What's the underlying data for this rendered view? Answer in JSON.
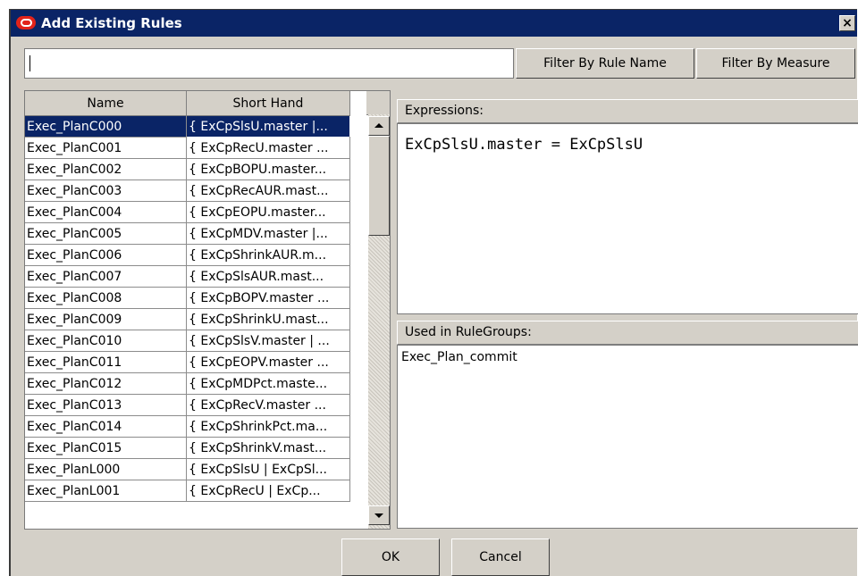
{
  "window": {
    "title": "Add Existing Rules",
    "close_label": "×"
  },
  "filter": {
    "value": "",
    "by_rule_name_label": "Filter By Rule Name",
    "by_measure_label": "Filter By Measure"
  },
  "table": {
    "columns": [
      "Name",
      "Short Hand"
    ],
    "selected_index": 0,
    "rows": [
      {
        "name": "Exec_PlanC000",
        "short": "{ ExCpSlsU.master |..."
      },
      {
        "name": "Exec_PlanC001",
        "short": "{ ExCpRecU.master ..."
      },
      {
        "name": "Exec_PlanC002",
        "short": "{ ExCpBOPU.master..."
      },
      {
        "name": "Exec_PlanC003",
        "short": "{ ExCpRecAUR.mast..."
      },
      {
        "name": "Exec_PlanC004",
        "short": "{ ExCpEOPU.master..."
      },
      {
        "name": "Exec_PlanC005",
        "short": "{ ExCpMDV.master |..."
      },
      {
        "name": "Exec_PlanC006",
        "short": "{ ExCpShrinkAUR.m..."
      },
      {
        "name": "Exec_PlanC007",
        "short": "{ ExCpSlsAUR.mast..."
      },
      {
        "name": "Exec_PlanC008",
        "short": "{ ExCpBOPV.master ..."
      },
      {
        "name": "Exec_PlanC009",
        "short": "{ ExCpShrinkU.mast..."
      },
      {
        "name": "Exec_PlanC010",
        "short": "{ ExCpSlsV.master | ..."
      },
      {
        "name": "Exec_PlanC011",
        "short": "{ ExCpEOPV.master ..."
      },
      {
        "name": "Exec_PlanC012",
        "short": "{ ExCpMDPct.maste..."
      },
      {
        "name": "Exec_PlanC013",
        "short": "{ ExCpRecV.master ..."
      },
      {
        "name": "Exec_PlanC014",
        "short": "{ ExCpShrinkPct.ma..."
      },
      {
        "name": "Exec_PlanC015",
        "short": "{ ExCpShrinkV.mast..."
      },
      {
        "name": "Exec_PlanL000",
        "short": "{ ExCpSlsU | ExCpSl..."
      },
      {
        "name": "Exec_PlanL001",
        "short": "{ ExCpRecU | ExCp..."
      }
    ]
  },
  "expressions": {
    "label": "Expressions:",
    "text": "ExCpSlsU.master = ExCpSlsU"
  },
  "used_in": {
    "label": "Used in RuleGroups:",
    "text": "Exec_Plan_commit"
  },
  "buttons": {
    "ok": "OK",
    "cancel": "Cancel"
  },
  "colors": {
    "titlebar": "#0a2466",
    "selection": "#0a2466",
    "dialog_bg": "#d4d0c8",
    "logo": "#e2231a"
  }
}
